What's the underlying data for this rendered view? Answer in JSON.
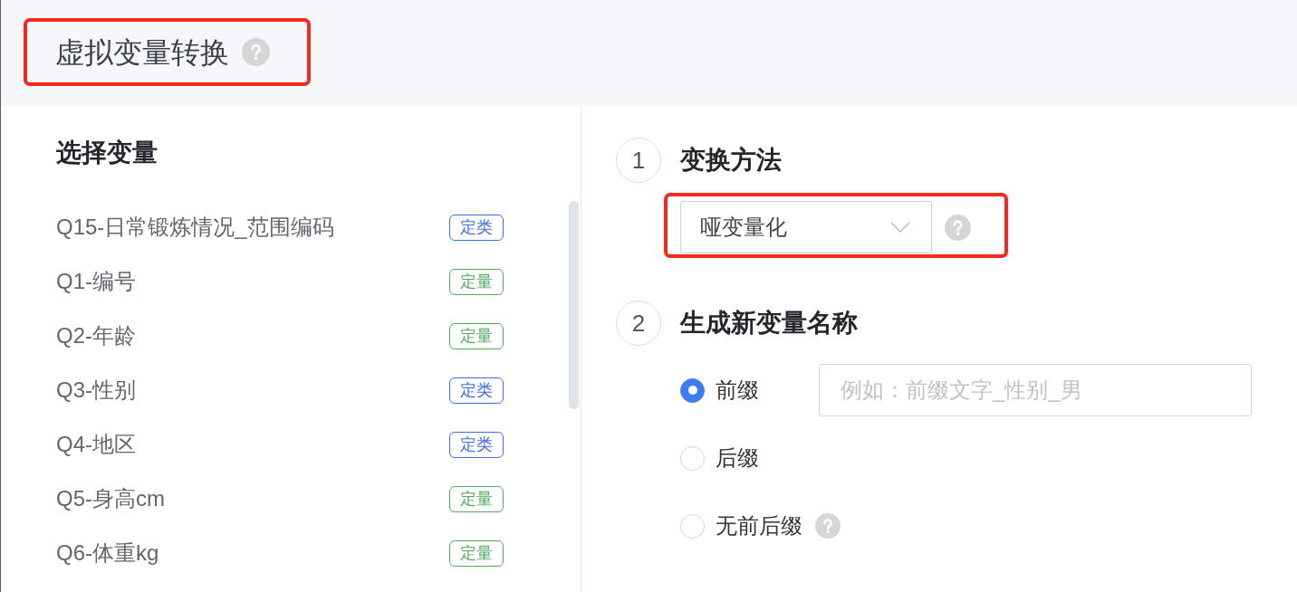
{
  "header": {
    "title": "虚拟变量转换",
    "help": true,
    "highlighted": true
  },
  "variables": {
    "title": "选择变量",
    "items": [
      {
        "name": "Q15-日常锻炼情况_范围编码",
        "tag": "定类",
        "color": "#3d6fe0"
      },
      {
        "name": "Q1-编号",
        "tag": "定量",
        "color": "#4fab5e"
      },
      {
        "name": "Q2-年龄",
        "tag": "定量",
        "color": "#4fab5e"
      },
      {
        "name": "Q3-性别",
        "tag": "定类",
        "color": "#3d6fe0"
      },
      {
        "name": "Q4-地区",
        "tag": "定类",
        "color": "#3d6fe0"
      },
      {
        "name": "Q5-身高cm",
        "tag": "定量",
        "color": "#4fab5e"
      },
      {
        "name": "Q6-体重kg",
        "tag": "定量",
        "color": "#4fab5e"
      }
    ]
  },
  "steps": [
    {
      "number": "1",
      "title": "变换方法",
      "kind": "select",
      "value": "哑变量化",
      "help": true,
      "highlighted": true
    },
    {
      "number": "2",
      "title": "生成新变量名称",
      "kind": "radio_group",
      "options": [
        {
          "label": "前缀",
          "selected": true,
          "input": {
            "placeholder": "例如：前缀文字_性别_男"
          }
        },
        {
          "label": "后缀",
          "selected": false
        },
        {
          "label": "无前后缀",
          "selected": false,
          "help": true
        }
      ]
    }
  ]
}
